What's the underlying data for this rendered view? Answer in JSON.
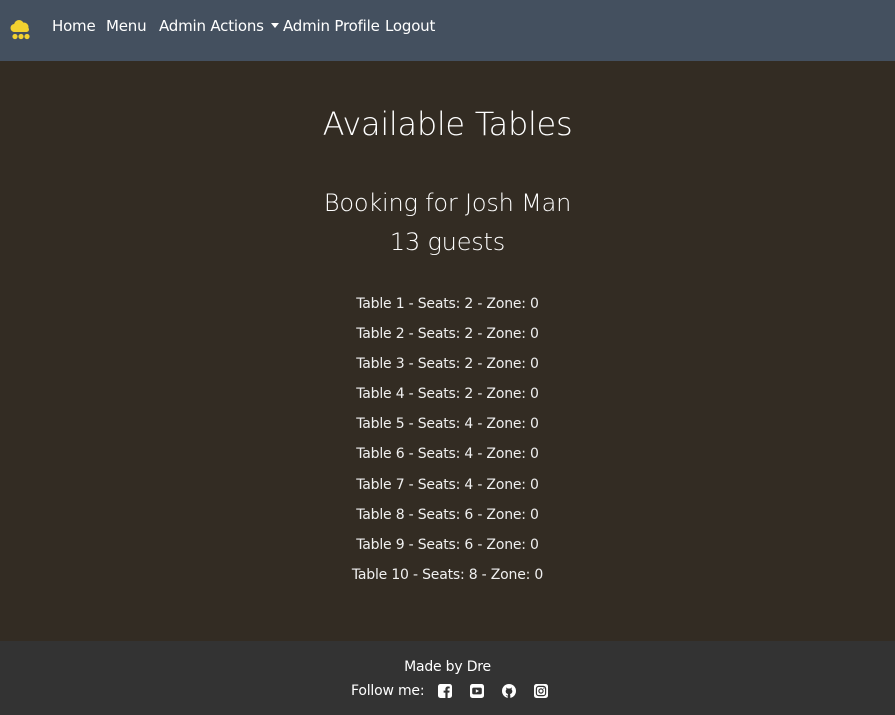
{
  "nav": {
    "brand_icon": "cloud-logo-icon",
    "home": "Home",
    "menu": "Menu",
    "admin_actions": "Admin Actions",
    "admin_profile": "Admin Profile",
    "logout": "Logout"
  },
  "main": {
    "title": "Available Tables",
    "booking_for": "Booking for Josh Man",
    "guests": "13 guests",
    "tables": [
      "Table 1 - Seats: 2 - Zone: 0",
      "Table 2 - Seats: 2 - Zone: 0",
      "Table 3 - Seats: 2 - Zone: 0",
      "Table 4 - Seats: 2 - Zone: 0",
      "Table 5 - Seats: 4 - Zone: 0",
      "Table 6 - Seats: 4 - Zone: 0",
      "Table 7 - Seats: 4 - Zone: 0",
      "Table 8 - Seats: 6 - Zone: 0",
      "Table 9 - Seats: 6 - Zone: 0",
      "Table 10 - Seats: 8 - Zone: 0"
    ]
  },
  "footer": {
    "made_by": "Made by Dre",
    "follow_me": "Follow me:",
    "social_icons": [
      "facebook-icon",
      "youtube-icon",
      "github-icon",
      "instagram-icon"
    ]
  },
  "colors": {
    "navbar": "#44505f",
    "page_background": "#332c23",
    "footer": "#333333",
    "brand_logo": "#f2d230",
    "text": "#ffffff"
  }
}
